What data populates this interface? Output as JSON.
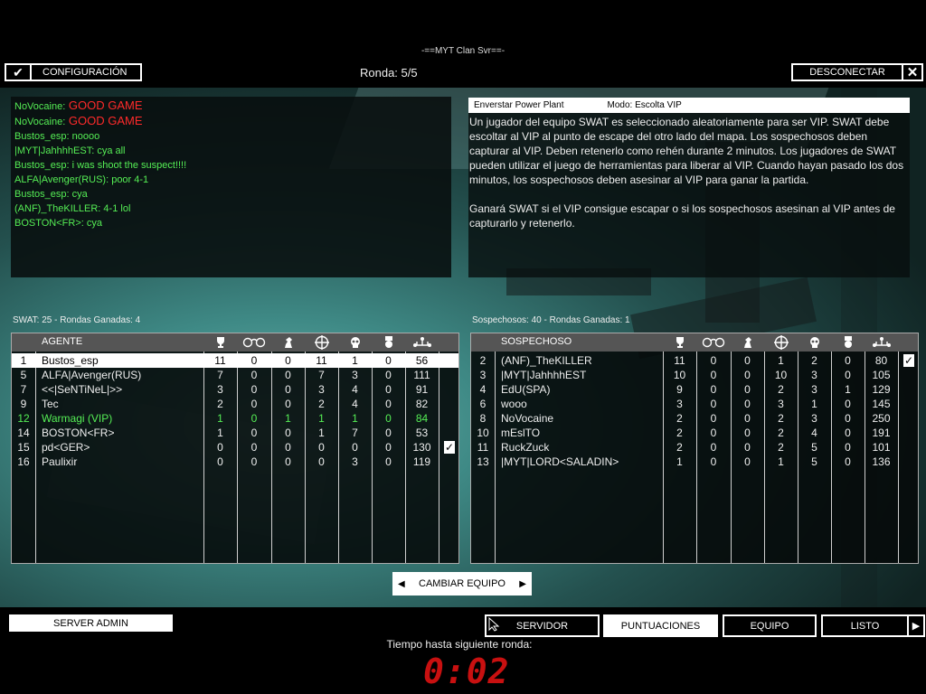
{
  "server_title": "-==MYT Clan Svr==-",
  "round": "Ronda: 5/5",
  "buttons": {
    "config": "CONFIGURACIÓN",
    "disconnect": "DESCONECTAR",
    "change_team": "CAMBIAR EQUIPO",
    "server_admin": "SERVER ADMIN"
  },
  "chat": [
    {
      "name": "NoVocaine:",
      "msg": "GOOD GAME",
      "color": "red"
    },
    {
      "name": "NoVocaine:",
      "msg": "GOOD GAME",
      "color": "red"
    },
    {
      "name": "Bustos_esp:",
      "msg": "noooo",
      "color": "green"
    },
    {
      "name": "|MYT|JahhhhEST:",
      "msg": "cya all",
      "color": "green"
    },
    {
      "name": "Bustos_esp:",
      "msg": "i was shoot the suspect!!!!",
      "color": "green"
    },
    {
      "name": "ALFA|Avenger(RUS):",
      "msg": "poor 4-1",
      "color": "green"
    },
    {
      "name": "Bustos_esp:",
      "msg": "cya",
      "color": "green"
    },
    {
      "name": "(ANF)_TheKILLER:",
      "msg": "4-1 lol",
      "color": "green"
    },
    {
      "name": "BOSTON<FR>:",
      "msg": "cya",
      "color": "green"
    }
  ],
  "map": {
    "name": "Enverstar Power Plant",
    "mode": "Modo: Escolta VIP",
    "desc1": "Un jugador del equipo SWAT es seleccionado aleatoriamente para ser VIP. SWAT debe escoltar al VIP al punto de escape del otro lado del mapa. Los sospechosos deben capturar al VIP. Deben retenerlo como rehén durante 2 minutos. Los jugadores de SWAT pueden utilizar el juego de herramientas para liberar al VIP. Cuando hayan pasado los dos minutos, los sospechosos deben asesinar al VIP para ganar la partida.",
    "desc2": "Ganará SWAT si el VIP consigue escapar o si los sospechosos asesinan al VIP antes de capturarlo y retenerlo."
  },
  "swat": {
    "summary": "SWAT: 25 - Rondas Ganadas: 4",
    "header": "AGENTE",
    "rows": [
      {
        "id": "1",
        "name": "Bustos_esp",
        "c1": "11",
        "c2": "0",
        "c3": "0",
        "c4": "11",
        "c5": "1",
        "c6": "0",
        "ping": "56",
        "selected": true
      },
      {
        "id": "5",
        "name": "ALFA|Avenger(RUS)",
        "c1": "7",
        "c2": "0",
        "c3": "0",
        "c4": "7",
        "c5": "3",
        "c6": "0",
        "ping": "111"
      },
      {
        "id": "7",
        "name": "<<|SeNTiNeL|>>",
        "c1": "3",
        "c2": "0",
        "c3": "0",
        "c4": "3",
        "c5": "4",
        "c6": "0",
        "ping": "91"
      },
      {
        "id": "9",
        "name": "Tec",
        "c1": "2",
        "c2": "0",
        "c3": "0",
        "c4": "2",
        "c5": "4",
        "c6": "0",
        "ping": "82"
      },
      {
        "id": "12",
        "name": "Warmagi (VIP)",
        "c1": "1",
        "c2": "0",
        "c3": "1",
        "c4": "1",
        "c5": "1",
        "c6": "0",
        "ping": "84",
        "vip": true
      },
      {
        "id": "14",
        "name": "BOSTON<FR>",
        "c1": "1",
        "c2": "0",
        "c3": "0",
        "c4": "1",
        "c5": "7",
        "c6": "0",
        "ping": "53"
      },
      {
        "id": "15",
        "name": "pd<GER>",
        "c1": "0",
        "c2": "0",
        "c3": "0",
        "c4": "0",
        "c5": "0",
        "c6": "0",
        "ping": "130",
        "ready": true
      },
      {
        "id": "16",
        "name": "Paulixir",
        "c1": "0",
        "c2": "0",
        "c3": "0",
        "c4": "0",
        "c5": "3",
        "c6": "0",
        "ping": "119"
      }
    ]
  },
  "suspects": {
    "summary": "Sospechosos: 40 - Rondas Ganadas: 1",
    "header": "SOSPECHOSO",
    "rows": [
      {
        "id": "2",
        "name": "(ANF)_TheKILLER",
        "c1": "11",
        "c2": "0",
        "c3": "0",
        "c4": "1",
        "c5": "2",
        "c6": "0",
        "ping": "80",
        "ready": true
      },
      {
        "id": "3",
        "name": "|MYT|JahhhhEST",
        "c1": "10",
        "c2": "0",
        "c3": "0",
        "c4": "10",
        "c5": "3",
        "c6": "0",
        "ping": "105"
      },
      {
        "id": "4",
        "name": "EdU(SPA)",
        "c1": "9",
        "c2": "0",
        "c3": "0",
        "c4": "2",
        "c5": "3",
        "c6": "1",
        "ping": "129"
      },
      {
        "id": "6",
        "name": "wooo",
        "c1": "3",
        "c2": "0",
        "c3": "0",
        "c4": "3",
        "c5": "1",
        "c6": "0",
        "ping": "145"
      },
      {
        "id": "8",
        "name": "NoVocaine",
        "c1": "2",
        "c2": "0",
        "c3": "0",
        "c4": "2",
        "c5": "3",
        "c6": "0",
        "ping": "250"
      },
      {
        "id": "10",
        "name": "mEslTO",
        "c1": "2",
        "c2": "0",
        "c3": "0",
        "c4": "2",
        "c5": "4",
        "c6": "0",
        "ping": "191"
      },
      {
        "id": "11",
        "name": "RuckZuck",
        "c1": "2",
        "c2": "0",
        "c3": "0",
        "c4": "2",
        "c5": "5",
        "c6": "0",
        "ping": "101"
      },
      {
        "id": "13",
        "name": "|MYT|LORD<SALADIN>",
        "c1": "1",
        "c2": "0",
        "c3": "0",
        "c4": "1",
        "c5": "5",
        "c6": "0",
        "ping": "136"
      }
    ]
  },
  "column_icons": [
    "trophy-icon",
    "handcuffs-icon",
    "chess-knight-icon",
    "crosshair-icon",
    "skull-icon",
    "medal-icon",
    "network-icon"
  ],
  "check_glyph": "✓",
  "nav": {
    "servidor": "SERVIDOR",
    "puntuaciones": "PUNTUACIONES",
    "equipo": "EQUIPO",
    "listo": "LISTO"
  },
  "timer_label": "Tiempo hasta siguiente ronda:",
  "timer": "0:02",
  "colors": {
    "chat_green": "#55ee55",
    "chat_red": "#ff2a2a",
    "timer_red": "#c81010"
  }
}
